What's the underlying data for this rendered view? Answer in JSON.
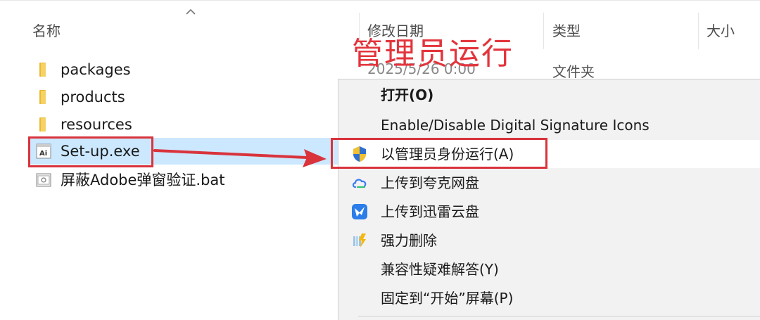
{
  "columns": {
    "name": "名称",
    "modified": "修改日期",
    "type": "类型",
    "size": "大小"
  },
  "files": [
    {
      "name": "packages",
      "kind": "folder"
    },
    {
      "name": "products",
      "kind": "folder"
    },
    {
      "name": "resources",
      "kind": "folder"
    },
    {
      "name": "Set-up.exe",
      "kind": "exe",
      "selected": true
    },
    {
      "name": "屏蔽Adobe弹窗验证.bat",
      "kind": "bat"
    }
  ],
  "first_row": {
    "date_partial": "2025/5/26 0:00",
    "type": "文件夹"
  },
  "annotation": {
    "title": "管理员运行",
    "color": "#e3343c"
  },
  "context_menu": {
    "items": [
      {
        "label": "打开(O)",
        "bold": true,
        "icon": ""
      },
      {
        "label": "Enable/Disable Digital Signature Icons",
        "icon": ""
      },
      {
        "label": "以管理员身份运行(A)",
        "icon": "uac-shield-icon",
        "highlighted": true
      },
      {
        "label": "上传到夸克网盘",
        "icon": "quark-cloud-icon"
      },
      {
        "label": "上传到迅雷云盘",
        "icon": "xunlei-bird-icon"
      },
      {
        "label": "强力删除",
        "icon": "shred-icon"
      },
      {
        "label": "兼容性疑难解答(Y)",
        "icon": ""
      },
      {
        "label": "固定到“开始”屏幕(P)",
        "icon": ""
      }
    ]
  },
  "colors": {
    "selection": "#cce8ff",
    "menu_bg": "#f2f2f2",
    "annotation_red": "#d9333c"
  }
}
